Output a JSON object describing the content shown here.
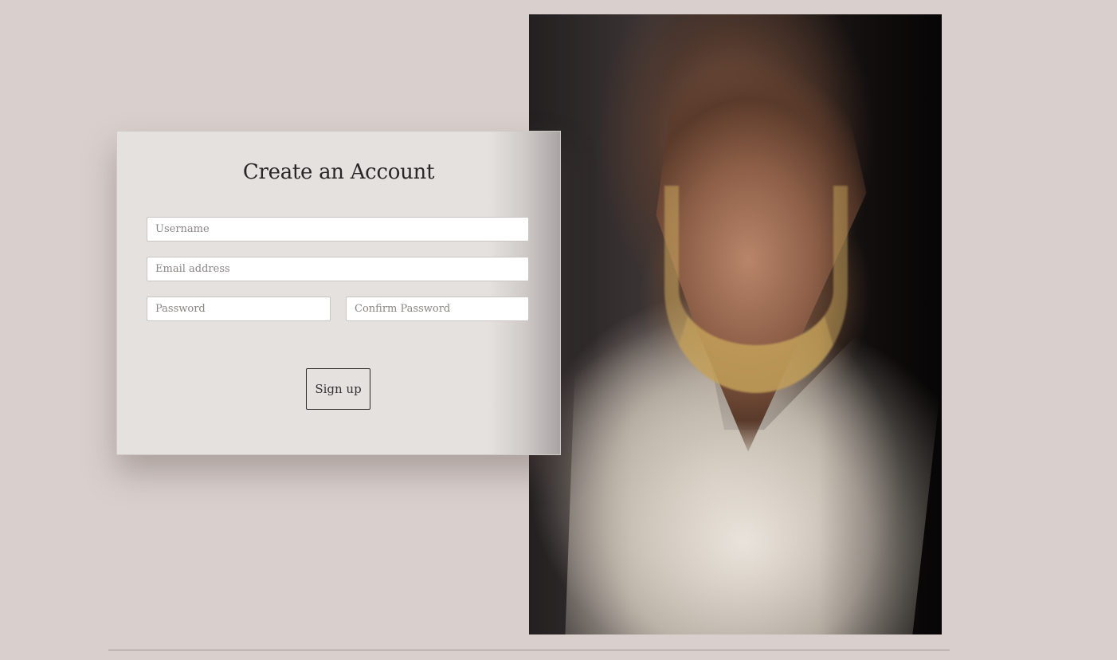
{
  "form": {
    "title": "Create an Account",
    "username_placeholder": "Username",
    "email_placeholder": "Email address",
    "password_placeholder": "Password",
    "confirm_password_placeholder": "Confirm Password",
    "signup_label": "Sign up"
  },
  "colors": {
    "background": "#d9cfcd",
    "card": "#e5e1df",
    "text": "#2a2626"
  }
}
